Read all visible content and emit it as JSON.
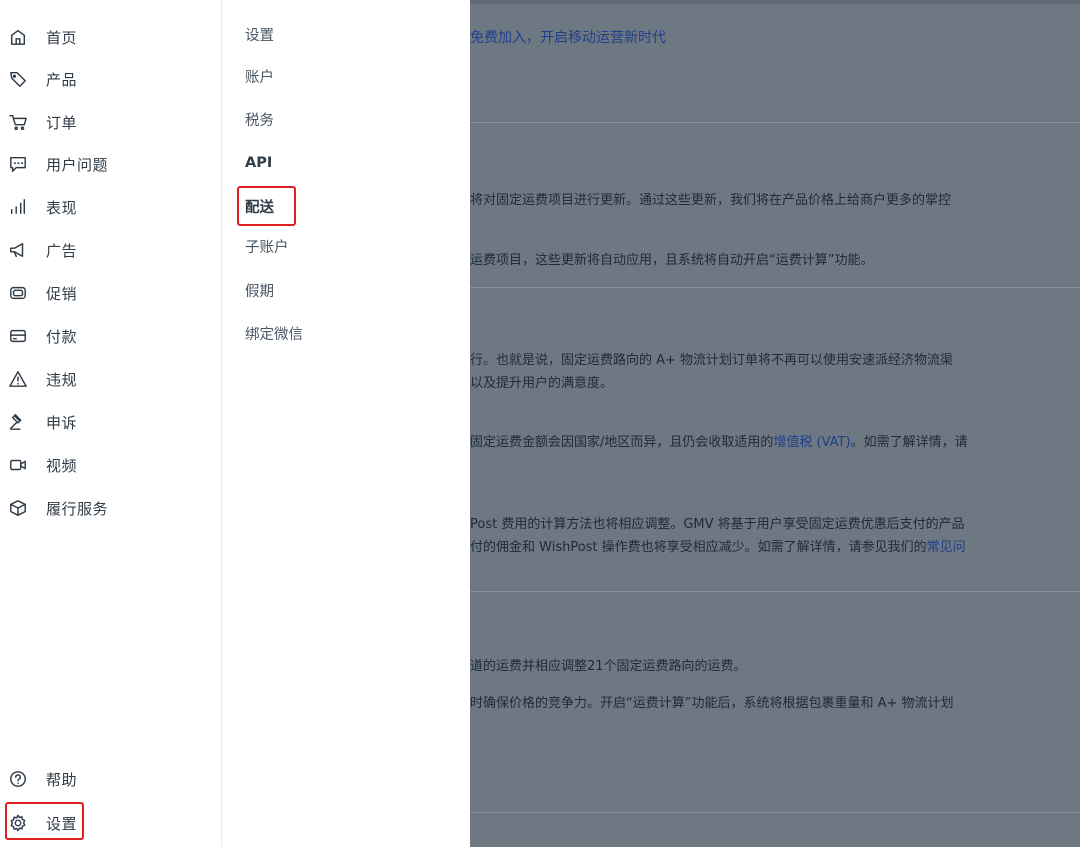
{
  "nav": {
    "items": [
      {
        "icon": "home-icon",
        "label": "首页"
      },
      {
        "icon": "tag-icon",
        "label": "产品"
      },
      {
        "icon": "cart-icon",
        "label": "订单"
      },
      {
        "icon": "chat-icon",
        "label": "用户问题"
      },
      {
        "icon": "bar-chart-icon",
        "label": "表现"
      },
      {
        "icon": "megaphone-icon",
        "label": "广告"
      },
      {
        "icon": "promo-icon",
        "label": "促销"
      },
      {
        "icon": "card-icon",
        "label": "付款"
      },
      {
        "icon": "warning-icon",
        "label": "违规"
      },
      {
        "icon": "gavel-icon",
        "label": "申诉"
      },
      {
        "icon": "video-icon",
        "label": "视频"
      },
      {
        "icon": "box-icon",
        "label": "履行服务"
      }
    ],
    "bottom": [
      {
        "icon": "help-icon",
        "label": "帮助"
      },
      {
        "icon": "gear-icon",
        "label": "设置"
      }
    ]
  },
  "submenu": {
    "items": [
      "设置",
      "账户",
      "税务",
      "API",
      "配送",
      "子账户",
      "假期",
      "绑定微信"
    ],
    "highlighted": "配送"
  },
  "main": {
    "banner": "免费加入，开启移动运营新时代",
    "lines": [
      "将对固定运费项目进行更新。通过这些更新，我们将在产品价格上给商户更多的掌控",
      "运费项目，这些更新将自动应用，且系统将自动开启“运费计算”功能。",
      "行。也就是说，固定运费路向的 A+ 物流计划订单将不再可以使用安速派经济物流渠",
      "以及提升用户的满意度。",
      "固定运费金额会因国家/地区而异，且仍会收取适用的",
      "增值税 (VAT)",
      "。如需了解详情，请",
      "Post 费用的计算方法也将相应调整。GMV 将基于用户享受固定运费优惠后支付的产品",
      "付的佣金和 WishPost 操作费也将享受相应减少。如需了解详情，请参见我们的",
      "常见问",
      "道的运费并相应调整21个固定运费路向的运费。",
      "时确保价格的竞争力。开启“运费计算”功能后，系统将根据包裹重量和 A+ 物流计划"
    ]
  },
  "colors": {
    "highlight": "#e02020",
    "overlay": "#6d7882",
    "link": "#1f3f8a"
  }
}
